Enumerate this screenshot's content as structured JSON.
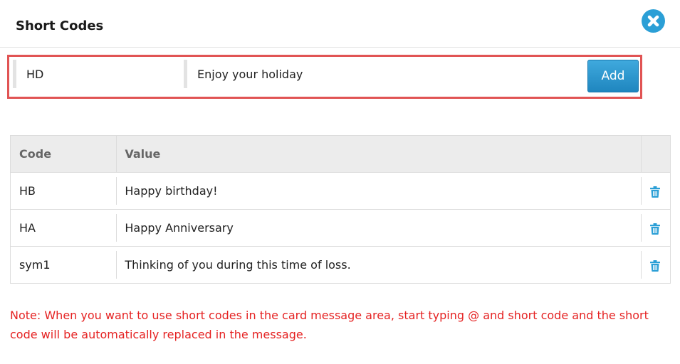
{
  "dialog": {
    "title": "Short Codes"
  },
  "form": {
    "code_value": "HD",
    "value_value": "Enjoy your holiday",
    "add_label": "Add"
  },
  "table": {
    "headers": [
      "Code",
      "Value",
      ""
    ],
    "rows": [
      {
        "code": "HB",
        "value": "Happy birthday!"
      },
      {
        "code": "HA",
        "value": "Happy Anniversary"
      },
      {
        "code": "sym1",
        "value": "Thinking of you during this time of loss."
      }
    ]
  },
  "note": "Note: When you want to use short codes in the card message area, start typing @ and short code and the short code will be automatically replaced in the message.",
  "colors": {
    "accent": "#2b9fd6",
    "highlight_border": "#e15454",
    "note_text": "#e52222"
  },
  "icons": {
    "close": "close-icon",
    "delete": "trash-icon"
  }
}
